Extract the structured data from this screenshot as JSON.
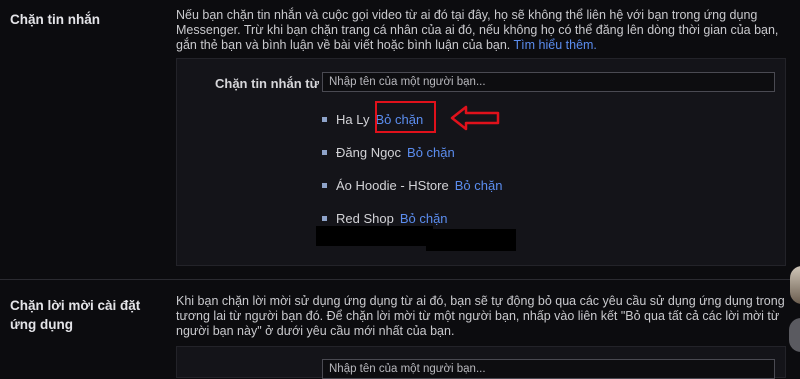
{
  "block_messages": {
    "title": "Chặn tin nhắn",
    "desc_text": "Nếu bạn chặn tin nhắn và cuộc gọi video từ ai đó tại đây, họ sẽ không thể liên hệ với bạn trong ứng dụng Messenger. Trừ khi bạn chặn trang cá nhân của ai đó, nếu không họ có thể đăng lên dòng thời gian của bạn, gắn thẻ bạn và bình luận về bài viết hoặc bình luận của bạn.",
    "learn_more": "Tìm hiểu thêm.",
    "input_label": "Chặn tin nhắn từ",
    "input_placeholder": "Nhập tên của một người bạn...",
    "blocked": [
      {
        "name": "Ha Ly",
        "action": "Bỏ chặn"
      },
      {
        "name": "Đăng Ngọc",
        "action": "Bỏ chặn"
      },
      {
        "name": "Áo Hoodie - HStore",
        "action": "Bỏ chặn"
      },
      {
        "name": "Red Shop",
        "action": "Bỏ chặn"
      }
    ]
  },
  "block_app_invites": {
    "title": "Chặn lời mời cài đặt ứng dụng",
    "desc_text": "Khi bạn chặn lời mời sử dụng ứng dụng từ ai đó, bạn sẽ tự động bỏ qua các yêu cầu sử dụng ứng dụng trong tương lai từ người bạn đó. Để chặn lời mời từ một người bạn, nhấp vào liên kết \"Bỏ qua tất cả các lời mời từ người bạn này\" ở dưới yêu cầu mới nhất của bạn.",
    "input_placeholder": "Nhập tên của một người bạn..."
  },
  "colors": {
    "link": "#5b8def",
    "annotation": "#e0111b",
    "background": "#0c0c0f"
  }
}
